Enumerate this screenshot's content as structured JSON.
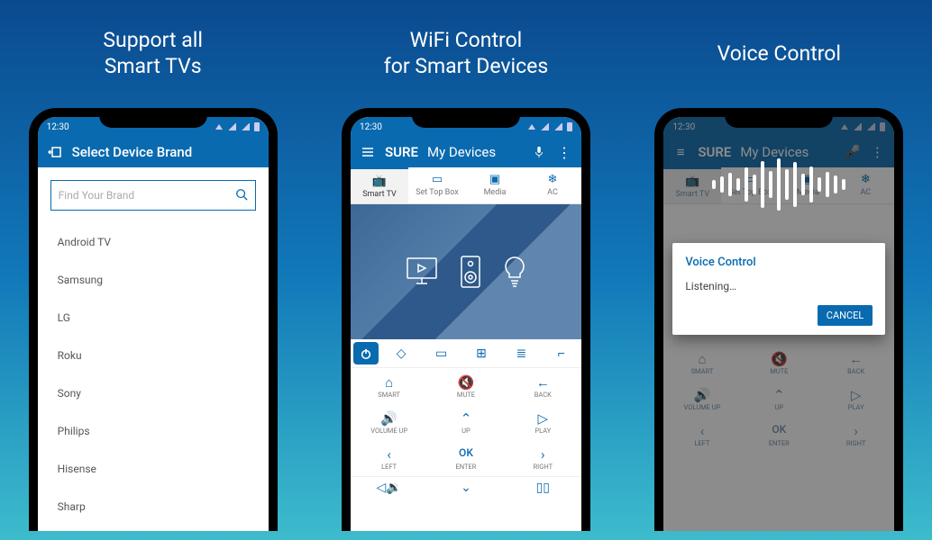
{
  "statusbar": {
    "time": "12:30"
  },
  "panel1": {
    "caption": "Support all\nSmart TVs",
    "title": "Select Device Brand",
    "search_placeholder": "Find Your Brand",
    "brands": [
      "Android TV",
      "Samsung",
      "LG",
      "Roku",
      "Sony",
      "Philips",
      "Hisense",
      "Sharp"
    ]
  },
  "panel2": {
    "caption": "WiFi Control\nfor Smart Devices",
    "app_name": "SURE",
    "header_title": "My Devices",
    "tabs": [
      {
        "label": "Smart TV",
        "active": true
      },
      {
        "label": "Set Top Box",
        "active": false
      },
      {
        "label": "Media",
        "active": false
      },
      {
        "label": "AC",
        "active": false
      }
    ],
    "remote_grid": [
      "SMART",
      "MUTE",
      "BACK",
      "VOLUME UP",
      "UP",
      "PLAY",
      "LEFT",
      "ENTER",
      "RIGHT"
    ],
    "enter_label": "OK"
  },
  "panel3": {
    "caption": "Voice Control",
    "dialog_title": "Voice Control",
    "dialog_status": "Listening…",
    "dialog_cancel": "CANCEL"
  }
}
